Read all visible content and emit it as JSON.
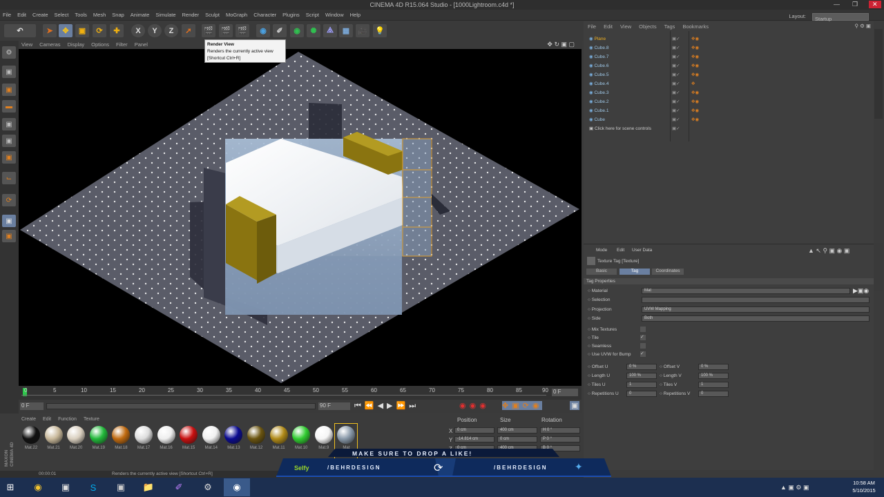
{
  "app": {
    "title": "CINEMA 4D R15.064 Studio - [1000Lightroom.c4d *]"
  },
  "menu": [
    "File",
    "Edit",
    "Create",
    "Select",
    "Tools",
    "Mesh",
    "Snap",
    "Animate",
    "Simulate",
    "Render",
    "Sculpt",
    "MoGraph",
    "Character",
    "Plugins",
    "Script",
    "Window",
    "Help"
  ],
  "layout": {
    "label": "Layout:",
    "value": "Startup"
  },
  "viewport": {
    "menu": [
      "View",
      "Cameras",
      "Display",
      "Options",
      "Filter",
      "Panel"
    ]
  },
  "tooltip": {
    "title": "Render View",
    "desc": "Renders the currently active view",
    "shortcut": "[Shortcut Ctrl+R]"
  },
  "timeline": {
    "ticks": [
      "0",
      "5",
      "10",
      "15",
      "20",
      "25",
      "30",
      "35",
      "40",
      "45",
      "50",
      "55",
      "60",
      "65",
      "70",
      "75",
      "80",
      "85",
      "90"
    ],
    "frame_end": "0 F",
    "start_field": "0 F",
    "end_field": "90 F"
  },
  "materials": {
    "menu": [
      "Create",
      "Edit",
      "Function",
      "Texture"
    ],
    "swatches": [
      {
        "name": "Mat.22",
        "color": "#111111"
      },
      {
        "name": "Mat.21",
        "color": "#c8b89a"
      },
      {
        "name": "Mat.20",
        "color": "#d9cfbf"
      },
      {
        "name": "Mat.19",
        "color": "#22b83a"
      },
      {
        "name": "Mat.18",
        "color": "#c06a10"
      },
      {
        "name": "Mat.17",
        "color": "#dddddd"
      },
      {
        "name": "Mat.16",
        "color": "#eeeeee"
      },
      {
        "name": "Mat.15",
        "color": "#c81010"
      },
      {
        "name": "Mat.14",
        "color": "#f0f0f0"
      },
      {
        "name": "Mat.13",
        "color": "#0a0a90"
      },
      {
        "name": "Mat.12",
        "color": "#6a5410"
      },
      {
        "name": "Mat.11",
        "color": "#b08a18"
      },
      {
        "name": "Mat.10",
        "color": "#30cc30"
      },
      {
        "name": "Mat.9",
        "color": "#f5f5f5"
      },
      {
        "name": "Mat",
        "color": "#8898a8"
      }
    ]
  },
  "coords": {
    "headers": [
      "Position",
      "Size",
      "Rotation"
    ],
    "rows": [
      {
        "axis": "X",
        "pos": "0 cm",
        "size": "400 cm",
        "rot": "H 0 °"
      },
      {
        "axis": "Y",
        "pos": "-14.814 cm",
        "size": "0 cm",
        "rot": "P 0 °"
      },
      {
        "axis": "Z",
        "pos": "0 cm",
        "size": "400 cm",
        "rot": "B 0 °"
      }
    ]
  },
  "objects": {
    "menu": [
      "File",
      "Edit",
      "View",
      "Objects",
      "Tags",
      "Bookmarks"
    ],
    "rows": [
      "Plane",
      "Cube.8",
      "Cube.7",
      "Cube.6",
      "Cube.5",
      "Cube.4",
      "Cube.3",
      "Cube.2",
      "Cube.1",
      "Cube",
      "Click here for scene controls"
    ]
  },
  "attributes": {
    "menu": [
      "Mode",
      "Edit",
      "User Data"
    ],
    "header": "Texture Tag [Texture]",
    "tabs": [
      "Basic",
      "Tag",
      "Coordinates"
    ],
    "section": "Tag Properties",
    "props": [
      {
        "label": "Material",
        "value": "Mat"
      },
      {
        "label": "Selection",
        "value": ""
      },
      {
        "label": "Projection",
        "value": "UVW Mapping"
      },
      {
        "label": "Side",
        "value": "Both"
      }
    ],
    "checks": [
      "Mix Textures",
      "Tile",
      "Seamless",
      "Use UVW for Bump"
    ],
    "offsets": [
      {
        "l": "Offset U",
        "v": "0 %",
        "l2": "Offset V",
        "v2": "0 %"
      },
      {
        "l": "Length U",
        "v": "100 %",
        "l2": "Length V",
        "v2": "100 %"
      },
      {
        "l": "Tiles U",
        "v": "1",
        "l2": "Tiles V",
        "v2": "1"
      },
      {
        "l": "Repetitions U",
        "v": "0",
        "l2": "Repetitions V",
        "v2": "0"
      }
    ]
  },
  "status": {
    "time": "00:00:01",
    "text": "Renders the currently active view [Shortcut Ctrl+R]"
  },
  "banner": {
    "top": "MAKE SURE TO DROP A LIKE!",
    "left_brand": "Selfy",
    "left_handle": "/BEHRDESIGN",
    "right_handle": "/BEHRDESIGN"
  },
  "c4d_side": [
    "MAXON",
    "CINEMA 4D"
  ],
  "taskbar": {
    "clock_time": "10:58 AM",
    "clock_date": "5/10/2015"
  }
}
